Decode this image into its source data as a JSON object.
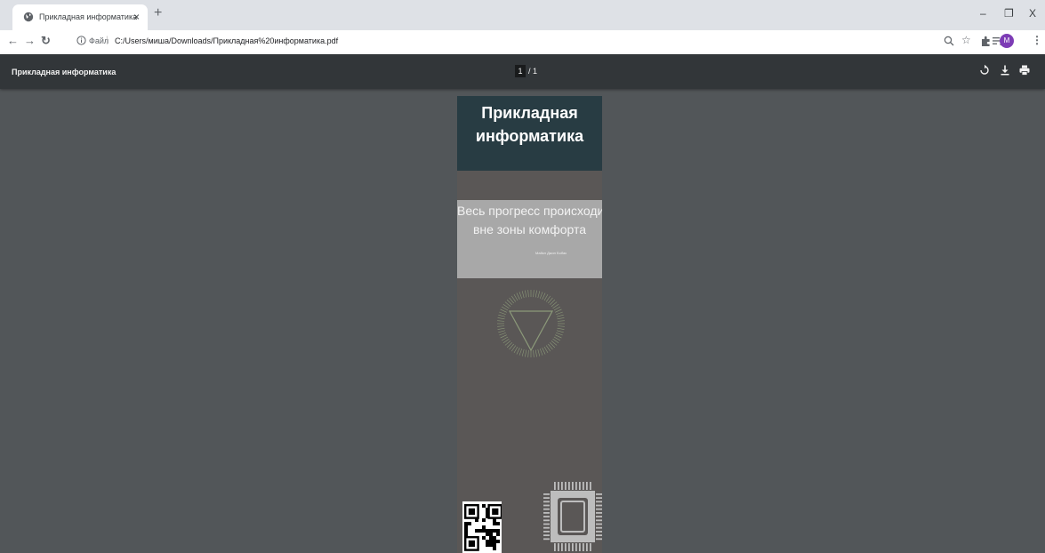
{
  "browser": {
    "tab": {
      "title": "Прикладная информатика",
      "close": "×"
    },
    "new_tab": "+",
    "window_controls": {
      "minimize": "–",
      "restore": "❐",
      "close": "X"
    },
    "address_bar": {
      "site_label": "Файл",
      "url": "C:/Users/миша/Downloads/Прикладная%20информатика.pdf"
    },
    "profile_initial": "M"
  },
  "pdf_viewer": {
    "title": "Прикладная информатика",
    "current_page": "1",
    "total_pages": "/ 1"
  },
  "document_page": {
    "heading": [
      "Прикладная",
      "информатика"
    ],
    "quote": [
      "Весь прогресс происходит",
      "вне зоны комфорта"
    ],
    "quote_author": "Майкл Джон Бобак"
  }
}
